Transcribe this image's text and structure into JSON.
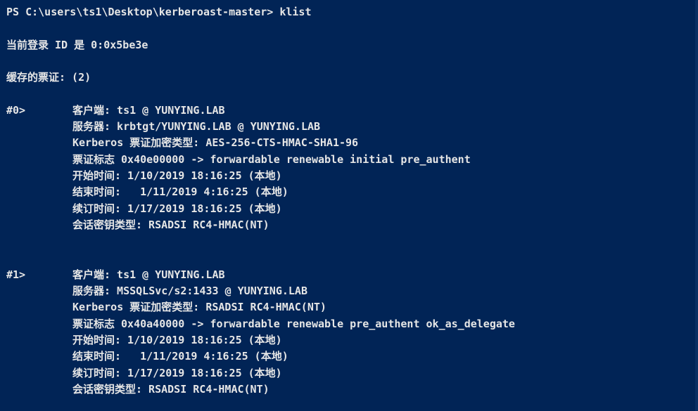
{
  "window": {
    "background_color": "#012456",
    "foreground_color": "#e6e6e6"
  },
  "prompt": {
    "text": "PS C:\\users\\ts1\\Desktop\\kerberoast-master> klist"
  },
  "session": {
    "login_id_text": "当前登录 ID 是 0:0x5be3e",
    "cached_tickets_text": "缓存的票证: (2)"
  },
  "tickets": [
    {
      "index_label": "#0>",
      "client": "客户端: ts1 @ YUNYING.LAB",
      "server": "服务器: krbtgt/YUNYING.LAB @ YUNYING.LAB",
      "kerberos_enc": "Kerberos 票证加密类型: AES-256-CTS-HMAC-SHA1-96",
      "flags": "票证标志 0x40e00000 -> forwardable renewable initial pre_authent",
      "start_time": "开始时间: 1/10/2019 18:16:25 (本地)",
      "end_time": "结束时间:   1/11/2019 4:16:25 (本地)",
      "renew_time": "续订时间: 1/17/2019 18:16:25 (本地)",
      "session_key": "会话密钥类型: RSADSI RC4-HMAC(NT)"
    },
    {
      "index_label": "#1>",
      "client": "客户端: ts1 @ YUNYING.LAB",
      "server": "服务器: MSSQLSvc/s2:1433 @ YUNYING.LAB",
      "kerberos_enc": "Kerberos 票证加密类型: RSADSI RC4-HMAC(NT)",
      "flags": "票证标志 0x40a40000 -> forwardable renewable pre_authent ok_as_delegate",
      "start_time": "开始时间: 1/10/2019 18:16:25 (本地)",
      "end_time": "结束时间:   1/11/2019 4:16:25 (本地)",
      "renew_time": "续订时间: 1/17/2019 18:16:25 (本地)",
      "session_key": "会话密钥类型: RSADSI RC4-HMAC(NT)"
    }
  ]
}
